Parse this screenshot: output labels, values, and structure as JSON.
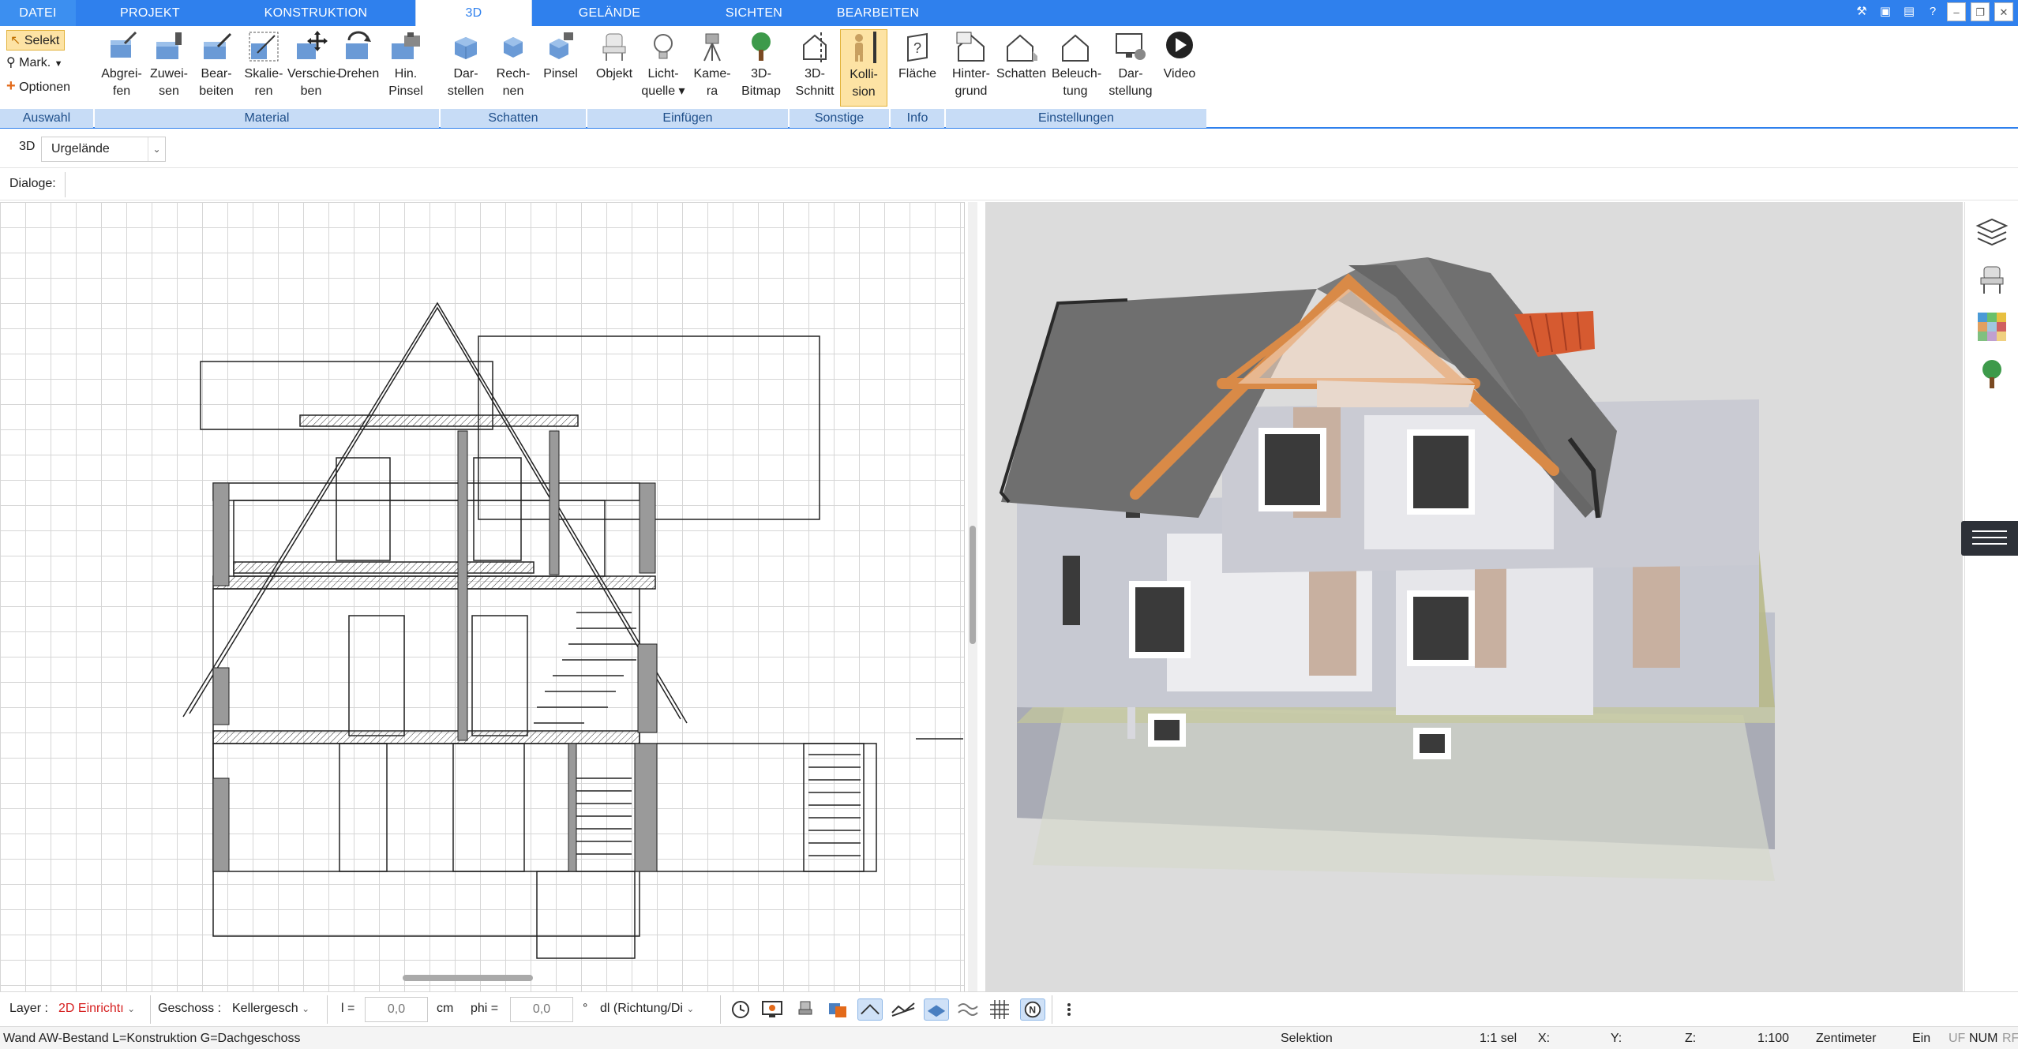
{
  "menu": {
    "tabs": [
      "DATEI",
      "PROJEKT",
      "KONSTRUKTION",
      "3D",
      "GELÄNDE",
      "SICHTEN",
      "BEARBEITEN"
    ],
    "active": "3D"
  },
  "ribbon": {
    "auswahl": {
      "selekt": "Selekt",
      "mark": "Mark.",
      "optionen": "Optionen",
      "group": "Auswahl"
    },
    "material": {
      "group": "Material",
      "buttons": [
        "Abgrei-\nfen",
        "Zuwei-\nsen",
        "Bear-\nbeiten",
        "Skalie-\nren",
        "Verschie-\nben",
        "Drehen",
        "Hin.\nPinsel"
      ]
    },
    "schatten": {
      "group": "Schatten",
      "buttons": [
        "Dar-\nstellen",
        "Rech-\nnen",
        "Pinsel"
      ]
    },
    "einfuegen": {
      "group": "Einfügen",
      "buttons": [
        "Objekt",
        "Licht-\nquelle ▾",
        "Kame-\nra",
        "3D-\nBitmap"
      ]
    },
    "sonstige": {
      "group": "Sonstige",
      "buttons": [
        "3D-\nSchnitt",
        "Kolli-\nsion"
      ]
    },
    "info": {
      "group": "Info",
      "buttons": [
        "Fläche"
      ]
    },
    "einstellungen": {
      "group": "Einstellungen",
      "buttons": [
        "Hinter-\ngrund",
        "Schatten",
        "Beleuch-\ntung",
        "Dar-\nstellung",
        "Video"
      ]
    }
  },
  "subbar": {
    "label": "3D",
    "terrain": "Urgelände"
  },
  "dialogbar": {
    "label": "Dialoge:"
  },
  "toolbar": {
    "layer_label": "Layer :",
    "layer_value": "2D Einrichtı",
    "geschoss_label": "Geschoss :",
    "geschoss_value": "Kellergesch",
    "l_label": "l =",
    "l_value": "0,0",
    "l_unit": "cm",
    "phi_label": "phi =",
    "phi_value": "0,0",
    "phi_unit": "°",
    "direction_value": "dl (Richtung/Di"
  },
  "statusbar": {
    "message": "Wand AW-Bestand L=Konstruktion G=Dachgeschoss",
    "mode": "Selektion",
    "scale_sel": "1:1 sel",
    "x": "X:",
    "y": "Y:",
    "z": "Z:",
    "scale": "1:100",
    "unit": "Zentimeter",
    "ein": "Ein",
    "uf": "UF",
    "num": "NUM",
    "rf": "RF"
  },
  "colors": {
    "accent": "#2f80ed",
    "ribbon_group": "#c7dcf6",
    "active_button": "#fde3a4",
    "layer_red": "#d62020"
  }
}
